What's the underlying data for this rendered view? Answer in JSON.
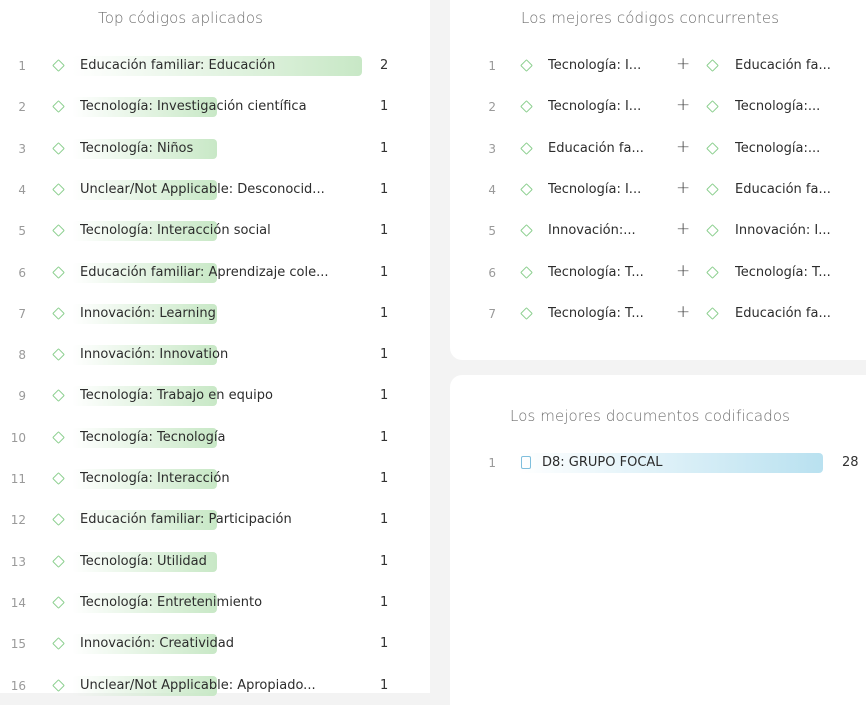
{
  "top_codes": {
    "title": "Top códigos aplicados",
    "items": [
      {
        "rank": "1",
        "label": "Educación familiar: Educación",
        "count": "2",
        "fraction": 1.0
      },
      {
        "rank": "2",
        "label": "Tecnología: Investigación científica",
        "count": "1",
        "fraction": 0.5
      },
      {
        "rank": "3",
        "label": "Tecnología: Niños",
        "count": "1",
        "fraction": 0.5
      },
      {
        "rank": "4",
        "label": "Unclear/Not Applicable: Desconocid...",
        "count": "1",
        "fraction": 0.5
      },
      {
        "rank": "5",
        "label": "Tecnología: Interacción social",
        "count": "1",
        "fraction": 0.5
      },
      {
        "rank": "6",
        "label": "Educación familiar: Aprendizaje cole...",
        "count": "1",
        "fraction": 0.5
      },
      {
        "rank": "7",
        "label": "Innovación: Learning",
        "count": "1",
        "fraction": 0.5
      },
      {
        "rank": "8",
        "label": "Innovación: Innovation",
        "count": "1",
        "fraction": 0.5
      },
      {
        "rank": "9",
        "label": "Tecnología: Trabajo en equipo",
        "count": "1",
        "fraction": 0.5
      },
      {
        "rank": "10",
        "label": "Tecnología: Tecnología",
        "count": "1",
        "fraction": 0.5
      },
      {
        "rank": "11",
        "label": "Tecnología: Interacción",
        "count": "1",
        "fraction": 0.5
      },
      {
        "rank": "12",
        "label": "Educación familiar: Participación",
        "count": "1",
        "fraction": 0.5
      },
      {
        "rank": "13",
        "label": "Tecnología: Utilidad",
        "count": "1",
        "fraction": 0.5
      },
      {
        "rank": "14",
        "label": "Tecnología: Entretenimiento",
        "count": "1",
        "fraction": 0.5
      },
      {
        "rank": "15",
        "label": "Innovación: Creatividad",
        "count": "1",
        "fraction": 0.5
      },
      {
        "rank": "16",
        "label": "Unclear/Not Applicable: Apropiado...",
        "count": "1",
        "fraction": 0.5
      }
    ]
  },
  "co_codes": {
    "title": "Los mejores códigos concurrentes",
    "plus_symbol": "+",
    "items": [
      {
        "rank": "1",
        "left": "Tecnología: I...",
        "right": "Educación fa..."
      },
      {
        "rank": "2",
        "left": "Tecnología: I...",
        "right": "Tecnología:..."
      },
      {
        "rank": "3",
        "left": "Educación fa...",
        "right": "Tecnología:..."
      },
      {
        "rank": "4",
        "left": "Tecnología: I...",
        "right": "Educación fa..."
      },
      {
        "rank": "5",
        "left": "Innovación:...",
        "right": "Innovación: I..."
      },
      {
        "rank": "6",
        "left": "Tecnología: T...",
        "right": "Tecnología: T..."
      },
      {
        "rank": "7",
        "left": "Tecnología: T...",
        "right": "Educación fa..."
      }
    ]
  },
  "top_docs": {
    "title": "Los mejores documentos codificados",
    "items": [
      {
        "rank": "1",
        "label": "D8: GRUPO FOCAL",
        "count": "28",
        "fraction": 1.0
      }
    ]
  },
  "colors": {
    "code_green": "#8ccf8f",
    "bar_green": "#c8e8c6",
    "doc_blue": "#7fbfdd",
    "bar_blue": "#b9e1f0"
  },
  "icons": {
    "code": "diamond-code-icon",
    "document": "document-icon"
  }
}
